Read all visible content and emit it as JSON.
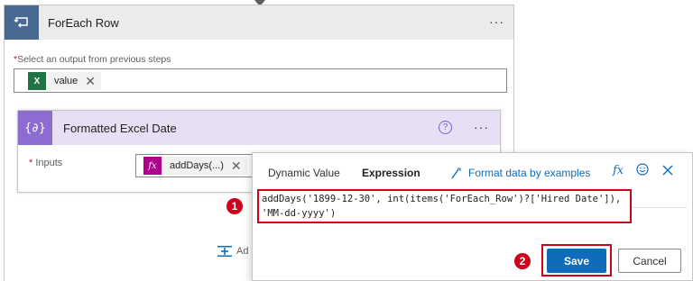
{
  "foreach": {
    "title": "ForEach Row",
    "more": "···",
    "required_mark": "*",
    "select_label": "Select an output from previous steps",
    "token": {
      "icon": "excel-icon",
      "label": "value",
      "remove": "✕"
    }
  },
  "compose": {
    "title": "Formatted Excel Date",
    "more": "···",
    "help": "?",
    "required_mark": "*",
    "inputs_label": "Inputs",
    "token": {
      "icon": "fx-icon",
      "fx": "fx",
      "label": "addDays(...)",
      "remove": "✕"
    }
  },
  "add_action": {
    "label": "Ad"
  },
  "popup": {
    "tabs": [
      {
        "label": "Dynamic Value",
        "active": false
      },
      {
        "label": "Expression",
        "active": true
      }
    ],
    "format_link": "Format data by examples",
    "header_icons": [
      "fx-icon",
      "smiley-icon",
      "close-icon"
    ],
    "fx": "fx",
    "expression": "addDays('1899-12-30', int(items('ForEach_Row')?['Hired Date']),\n'MM-dd-yyyy')",
    "save_label": "Save",
    "cancel_label": "Cancel"
  },
  "callouts": {
    "step1": "1",
    "step2": "2"
  },
  "colors": {
    "foreach_icon_bg": "#486991",
    "compose_icon_bg": "#8c6cd0",
    "compose_header_bg": "#e7e0f4",
    "accent": "#0f6cbd",
    "callout": "#d0021b",
    "excel": "#217346",
    "fx": "#ad008c"
  }
}
